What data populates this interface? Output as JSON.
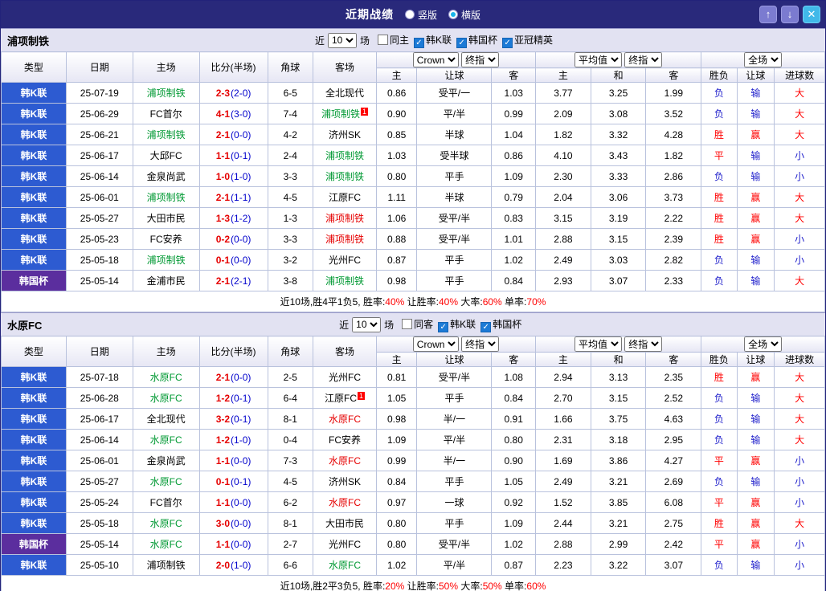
{
  "titlebar": {
    "title": "近期战绩",
    "view_options": [
      {
        "label": "竖版",
        "selected": false
      },
      {
        "label": "横版",
        "selected": true
      }
    ],
    "buttons": {
      "up": "↑",
      "down": "↓",
      "close": "✕"
    }
  },
  "colors": {
    "titlebar_bg": "#29297b",
    "league_k_bg": "#2d5bd1",
    "league_cup_bg": "#5b2e9e",
    "team_highlight_green": "#009933",
    "team_highlight_red": "#e60000",
    "positive_red": "#ff0000",
    "negative_blue": "#2222cc",
    "section_bar_bg": "#e2e2f2"
  },
  "filter_labels": {
    "near": "近",
    "count": "10",
    "games": "场"
  },
  "table_header": {
    "type": "类型",
    "date": "日期",
    "home": "主场",
    "score": "比分(半场)",
    "corner": "角球",
    "away": "客场",
    "book_select": "Crown",
    "final_select": "终指",
    "avg_select": "平均值",
    "scope_select": "全场",
    "sub_headers": [
      "主",
      "让球",
      "客",
      "主",
      "和",
      "客",
      "胜负",
      "让球",
      "进球数"
    ]
  },
  "sections": [
    {
      "team": "浦项制铁",
      "filters": [
        {
          "label": "同主",
          "checked": false
        },
        {
          "label": "韩K联",
          "checked": true
        },
        {
          "label": "韩国杯",
          "checked": true
        },
        {
          "label": "亚冠精英",
          "checked": true
        }
      ],
      "rows": [
        {
          "league": "韩K联",
          "cup": false,
          "date": "25-07-19",
          "home": "浦项制铁",
          "home_hl": "green",
          "home_badge": "",
          "score": "2-3",
          "half": "(2-0)",
          "corner": "6-5",
          "away": "全北现代",
          "away_hl": "",
          "away_badge": "",
          "odds": [
            "0.86",
            "受平/一",
            "1.03"
          ],
          "avg": [
            "3.77",
            "3.25",
            "1.99"
          ],
          "result": [
            "负",
            "输",
            "大"
          ]
        },
        {
          "league": "韩K联",
          "cup": false,
          "date": "25-06-29",
          "home": "FC首尔",
          "home_hl": "",
          "home_badge": "",
          "score": "4-1",
          "half": "(3-0)",
          "corner": "7-4",
          "away": "浦项制铁",
          "away_hl": "green",
          "away_badge": "1",
          "odds": [
            "0.90",
            "平/半",
            "0.99"
          ],
          "avg": [
            "2.09",
            "3.08",
            "3.52"
          ],
          "result": [
            "负",
            "输",
            "大"
          ]
        },
        {
          "league": "韩K联",
          "cup": false,
          "date": "25-06-21",
          "home": "浦项制铁",
          "home_hl": "green",
          "home_badge": "",
          "score": "2-1",
          "half": "(0-0)",
          "corner": "4-2",
          "away": "济州SK",
          "away_hl": "",
          "away_badge": "",
          "odds": [
            "0.85",
            "半球",
            "1.04"
          ],
          "avg": [
            "1.82",
            "3.32",
            "4.28"
          ],
          "result": [
            "胜",
            "赢",
            "大"
          ]
        },
        {
          "league": "韩K联",
          "cup": false,
          "date": "25-06-17",
          "home": "大邱FC",
          "home_hl": "",
          "home_badge": "",
          "score": "1-1",
          "half": "(0-1)",
          "corner": "2-4",
          "away": "浦项制铁",
          "away_hl": "green",
          "away_badge": "",
          "odds": [
            "1.03",
            "受半球",
            "0.86"
          ],
          "avg": [
            "4.10",
            "3.43",
            "1.82"
          ],
          "result": [
            "平",
            "输",
            "小"
          ]
        },
        {
          "league": "韩K联",
          "cup": false,
          "date": "25-06-14",
          "home": "金泉尚武",
          "home_hl": "",
          "home_badge": "",
          "score": "1-0",
          "half": "(1-0)",
          "corner": "3-3",
          "away": "浦项制铁",
          "away_hl": "green",
          "away_badge": "",
          "odds": [
            "0.80",
            "平手",
            "1.09"
          ],
          "avg": [
            "2.30",
            "3.33",
            "2.86"
          ],
          "result": [
            "负",
            "输",
            "小"
          ]
        },
        {
          "league": "韩K联",
          "cup": false,
          "date": "25-06-01",
          "home": "浦项制铁",
          "home_hl": "green",
          "home_badge": "",
          "score": "2-1",
          "half": "(1-1)",
          "corner": "4-5",
          "away": "江原FC",
          "away_hl": "",
          "away_badge": "",
          "odds": [
            "1.11",
            "半球",
            "0.79"
          ],
          "avg": [
            "2.04",
            "3.06",
            "3.73"
          ],
          "result": [
            "胜",
            "赢",
            "大"
          ]
        },
        {
          "league": "韩K联",
          "cup": false,
          "date": "25-05-27",
          "home": "大田市民",
          "home_hl": "",
          "home_badge": "",
          "score": "1-3",
          "half": "(1-2)",
          "corner": "1-3",
          "away": "浦项制铁",
          "away_hl": "red",
          "away_badge": "",
          "odds": [
            "1.06",
            "受平/半",
            "0.83"
          ],
          "avg": [
            "3.15",
            "3.19",
            "2.22"
          ],
          "result": [
            "胜",
            "赢",
            "大"
          ]
        },
        {
          "league": "韩K联",
          "cup": false,
          "date": "25-05-23",
          "home": "FC安养",
          "home_hl": "",
          "home_badge": "",
          "score": "0-2",
          "half": "(0-0)",
          "corner": "3-3",
          "away": "浦项制铁",
          "away_hl": "red",
          "away_badge": "",
          "odds": [
            "0.88",
            "受平/半",
            "1.01"
          ],
          "avg": [
            "2.88",
            "3.15",
            "2.39"
          ],
          "result": [
            "胜",
            "赢",
            "小"
          ]
        },
        {
          "league": "韩K联",
          "cup": false,
          "date": "25-05-18",
          "home": "浦项制铁",
          "home_hl": "green",
          "home_badge": "",
          "score": "0-1",
          "half": "(0-0)",
          "corner": "3-2",
          "away": "光州FC",
          "away_hl": "",
          "away_badge": "",
          "odds": [
            "0.87",
            "平手",
            "1.02"
          ],
          "avg": [
            "2.49",
            "3.03",
            "2.82"
          ],
          "result": [
            "负",
            "输",
            "小"
          ]
        },
        {
          "league": "韩国杯",
          "cup": true,
          "date": "25-05-14",
          "home": "金浦市民",
          "home_hl": "",
          "home_badge": "",
          "score": "2-1",
          "half": "(2-1)",
          "corner": "3-8",
          "away": "浦项制铁",
          "away_hl": "green",
          "away_badge": "",
          "odds": [
            "0.98",
            "平手",
            "0.84"
          ],
          "avg": [
            "2.93",
            "3.07",
            "2.33"
          ],
          "result": [
            "负",
            "输",
            "大"
          ]
        }
      ],
      "summary": [
        {
          "text": "近10场,胜4平1负5,",
          "color": "black"
        },
        {
          "text": " 胜率:",
          "color": "black"
        },
        {
          "text": "40%",
          "color": "red"
        },
        {
          "text": " 让胜率:",
          "color": "black"
        },
        {
          "text": "40%",
          "color": "red"
        },
        {
          "text": " 大率:",
          "color": "black"
        },
        {
          "text": "60%",
          "color": "red"
        },
        {
          "text": " 单率:",
          "color": "black"
        },
        {
          "text": "70%",
          "color": "red"
        }
      ]
    },
    {
      "team": "水原FC",
      "filters": [
        {
          "label": "同客",
          "checked": false
        },
        {
          "label": "韩K联",
          "checked": true
        },
        {
          "label": "韩国杯",
          "checked": true
        }
      ],
      "rows": [
        {
          "league": "韩K联",
          "cup": false,
          "date": "25-07-18",
          "home": "水原FC",
          "home_hl": "green",
          "home_badge": "",
          "score": "2-1",
          "half": "(0-0)",
          "corner": "2-5",
          "away": "光州FC",
          "away_hl": "",
          "away_badge": "",
          "odds": [
            "0.81",
            "受平/半",
            "1.08"
          ],
          "avg": [
            "2.94",
            "3.13",
            "2.35"
          ],
          "result": [
            "胜",
            "赢",
            "大"
          ]
        },
        {
          "league": "韩K联",
          "cup": false,
          "date": "25-06-28",
          "home": "水原FC",
          "home_hl": "green",
          "home_badge": "",
          "score": "1-2",
          "half": "(0-1)",
          "corner": "6-4",
          "away": "江原FC",
          "away_hl": "",
          "away_badge": "1",
          "odds": [
            "1.05",
            "平手",
            "0.84"
          ],
          "avg": [
            "2.70",
            "3.15",
            "2.52"
          ],
          "result": [
            "负",
            "输",
            "大"
          ]
        },
        {
          "league": "韩K联",
          "cup": false,
          "date": "25-06-17",
          "home": "全北现代",
          "home_hl": "",
          "home_badge": "",
          "score": "3-2",
          "half": "(0-1)",
          "corner": "8-1",
          "away": "水原FC",
          "away_hl": "red",
          "away_badge": "",
          "odds": [
            "0.98",
            "半/一",
            "0.91"
          ],
          "avg": [
            "1.66",
            "3.75",
            "4.63"
          ],
          "result": [
            "负",
            "输",
            "大"
          ]
        },
        {
          "league": "韩K联",
          "cup": false,
          "date": "25-06-14",
          "home": "水原FC",
          "home_hl": "green",
          "home_badge": "",
          "score": "1-2",
          "half": "(1-0)",
          "corner": "0-4",
          "away": "FC安养",
          "away_hl": "",
          "away_badge": "",
          "odds": [
            "1.09",
            "平/半",
            "0.80"
          ],
          "avg": [
            "2.31",
            "3.18",
            "2.95"
          ],
          "result": [
            "负",
            "输",
            "大"
          ]
        },
        {
          "league": "韩K联",
          "cup": false,
          "date": "25-06-01",
          "home": "金泉尚武",
          "home_hl": "",
          "home_badge": "",
          "score": "1-1",
          "half": "(0-0)",
          "corner": "7-3",
          "away": "水原FC",
          "away_hl": "red",
          "away_badge": "",
          "odds": [
            "0.99",
            "半/一",
            "0.90"
          ],
          "avg": [
            "1.69",
            "3.86",
            "4.27"
          ],
          "result": [
            "平",
            "赢",
            "小"
          ]
        },
        {
          "league": "韩K联",
          "cup": false,
          "date": "25-05-27",
          "home": "水原FC",
          "home_hl": "green",
          "home_badge": "",
          "score": "0-1",
          "half": "(0-1)",
          "corner": "4-5",
          "away": "济州SK",
          "away_hl": "",
          "away_badge": "",
          "odds": [
            "0.84",
            "平手",
            "1.05"
          ],
          "avg": [
            "2.49",
            "3.21",
            "2.69"
          ],
          "result": [
            "负",
            "输",
            "小"
          ]
        },
        {
          "league": "韩K联",
          "cup": false,
          "date": "25-05-24",
          "home": "FC首尔",
          "home_hl": "",
          "home_badge": "",
          "score": "1-1",
          "half": "(0-0)",
          "corner": "6-2",
          "away": "水原FC",
          "away_hl": "red",
          "away_badge": "",
          "odds": [
            "0.97",
            "一球",
            "0.92"
          ],
          "avg": [
            "1.52",
            "3.85",
            "6.08"
          ],
          "result": [
            "平",
            "赢",
            "小"
          ]
        },
        {
          "league": "韩K联",
          "cup": false,
          "date": "25-05-18",
          "home": "水原FC",
          "home_hl": "green",
          "home_badge": "",
          "score": "3-0",
          "half": "(0-0)",
          "corner": "8-1",
          "away": "大田市民",
          "away_hl": "",
          "away_badge": "",
          "odds": [
            "0.80",
            "平手",
            "1.09"
          ],
          "avg": [
            "2.44",
            "3.21",
            "2.75"
          ],
          "result": [
            "胜",
            "赢",
            "大"
          ]
        },
        {
          "league": "韩国杯",
          "cup": true,
          "date": "25-05-14",
          "home": "水原FC",
          "home_hl": "green",
          "home_badge": "",
          "score": "1-1",
          "half": "(0-0)",
          "corner": "2-7",
          "away": "光州FC",
          "away_hl": "",
          "away_badge": "",
          "odds": [
            "0.80",
            "受平/半",
            "1.02"
          ],
          "avg": [
            "2.88",
            "2.99",
            "2.42"
          ],
          "result": [
            "平",
            "赢",
            "小"
          ]
        },
        {
          "league": "韩K联",
          "cup": false,
          "date": "25-05-10",
          "home": "浦项制铁",
          "home_hl": "",
          "home_badge": "",
          "score": "2-0",
          "half": "(1-0)",
          "corner": "6-6",
          "away": "水原FC",
          "away_hl": "green",
          "away_badge": "",
          "odds": [
            "1.02",
            "平/半",
            "0.87"
          ],
          "avg": [
            "2.23",
            "3.22",
            "3.07"
          ],
          "result": [
            "负",
            "输",
            "小"
          ]
        }
      ],
      "summary": [
        {
          "text": "近10场,胜2平3负5,",
          "color": "black"
        },
        {
          "text": " 胜率:",
          "color": "black"
        },
        {
          "text": "20%",
          "color": "red"
        },
        {
          "text": " 让胜率:",
          "color": "black"
        },
        {
          "text": "50%",
          "color": "red"
        },
        {
          "text": " 大率:",
          "color": "black"
        },
        {
          "text": "50%",
          "color": "red"
        },
        {
          "text": " 单率:",
          "color": "black"
        },
        {
          "text": "60%",
          "color": "red"
        }
      ]
    }
  ]
}
